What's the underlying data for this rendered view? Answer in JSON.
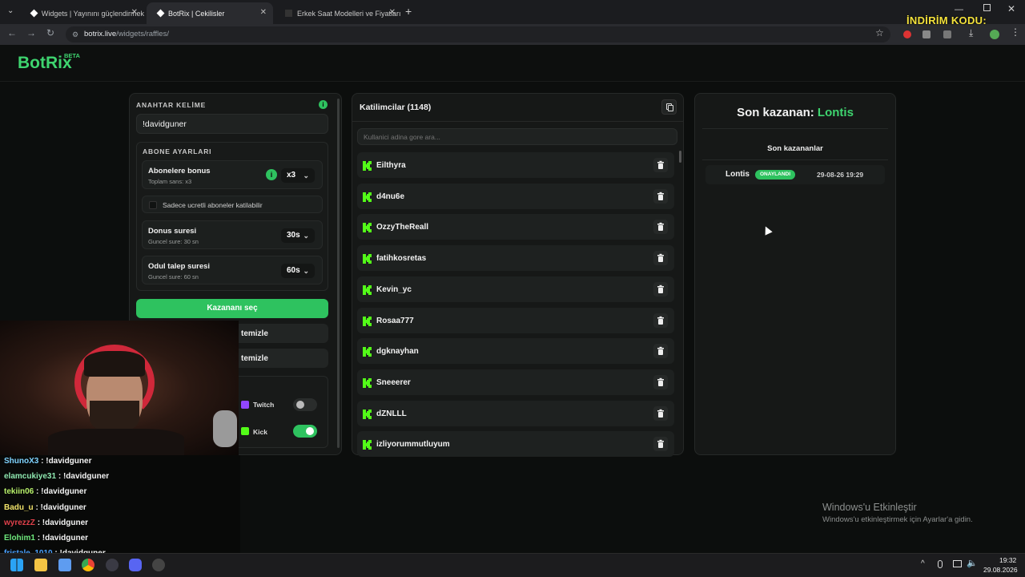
{
  "browser": {
    "tabs": [
      {
        "title": "Widgets | Yayınını güçlendirmek"
      },
      {
        "title": "BotRix | Cekilisler"
      },
      {
        "title": "Erkek Saat Modelleri ve Fiyatları"
      }
    ],
    "url_host": "botrix.live",
    "url_path": "/widgets/raffles/",
    "promo_text": "İNDİRİM KODU:"
  },
  "app": {
    "logo": "BotRix",
    "badge": "BETA"
  },
  "settings": {
    "keyword_label": "ANAHTAR KELİME",
    "keyword_value": "!davidguner",
    "subscriber_section": "ABONE AYARLARI",
    "bonus": {
      "title": "Abonelere bonus",
      "sub": "Toplam sans: x3",
      "value": "x3"
    },
    "paid_only": "Sadece ucretli aboneler katilabilir",
    "bonus_time": {
      "title": "Donus suresi",
      "sub": "Guncel sure: 30 sn",
      "value": "30s"
    },
    "claim_time": {
      "title": "Odul talep suresi",
      "sub": "Guncel sure: 60 sn",
      "value": "60s"
    },
    "pick_button": "Kazananı seç",
    "clear_1": "temizle",
    "clear_2": "temizle",
    "platforms": [
      {
        "name": "Twitch",
        "enabled": false
      },
      {
        "name": "Kick",
        "enabled": true
      }
    ]
  },
  "participants": {
    "title": "Katilimcilar (1148)",
    "search_placeholder": "Kullanici adina gore ara...",
    "list": [
      "Eilthyra",
      "d4nu6e",
      "OzzyTheReall",
      "fatihkosretas",
      "Kevin_yc",
      "Rosaa777",
      "dgknayhan",
      "Sneeerer",
      "dZNLLL",
      "izliyorummutluyum"
    ]
  },
  "winner": {
    "prefix": "Son kazanan:",
    "name": "Lontis",
    "history_title": "Son kazananlar",
    "history": [
      {
        "name": "Lontis",
        "status": "ONAYLANDI",
        "time": "29-08-26 19:29"
      }
    ]
  },
  "chat": [
    {
      "user": "ShunoX3",
      "msg": ": !davidguner",
      "color": "#7fd3ff"
    },
    {
      "user": "elamcukiye31",
      "msg": ": !davidguner",
      "color": "#8ee8b0"
    },
    {
      "user": "tekiin06",
      "msg": ": !davidguner",
      "color": "#b7f06a"
    },
    {
      "user": "Badu_u",
      "msg": ": !davidguner",
      "color": "#f1e36a"
    },
    {
      "user": "wyrezzZ",
      "msg": ": !davidguner",
      "color": "#e0414b"
    },
    {
      "user": "Elohim1",
      "msg": ": !davidguner",
      "color": "#6ee87c"
    },
    {
      "user": "fristale_1010",
      "msg": ": !davidguner",
      "color": "#4aa0ff"
    }
  ],
  "windows": {
    "activate_title": "Windows'u Etkinleştir",
    "activate_sub": "Windows'u etkinleştirmek için Ayarlar'a gidin.",
    "time": "19:32",
    "date": "29.08.2026"
  }
}
